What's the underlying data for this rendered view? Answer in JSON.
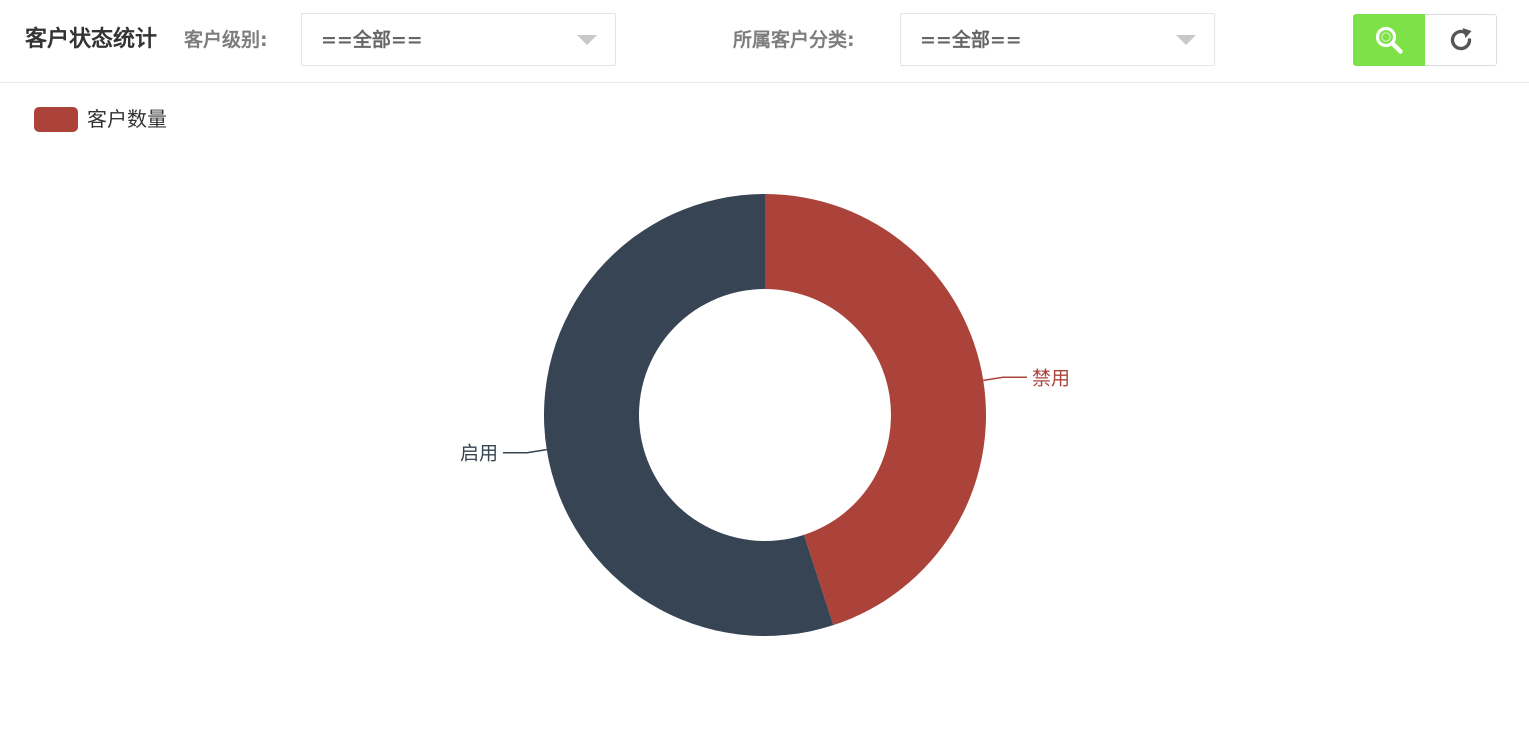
{
  "header": {
    "title": "客户状态统计",
    "level_label": "客户级别:",
    "level_value": "==全部==",
    "category_label": "所属客户分类:",
    "category_value": "==全部==",
    "search_icon": "search-icon",
    "refresh_icon": "refresh-icon"
  },
  "colors": {
    "accent_green": "#7de147",
    "slice_disabled": "#ab433a",
    "slice_enabled": "#364453"
  },
  "chart_data": {
    "type": "pie",
    "legend": [
      "客户数量"
    ],
    "series": [
      {
        "name": "客户数量",
        "data": [
          {
            "label": "禁用",
            "value": 45,
            "color": "#ab433a"
          },
          {
            "label": "启用",
            "value": 55,
            "color": "#364453"
          }
        ]
      }
    ],
    "title": "",
    "legend_position": "top-left",
    "donut": true
  }
}
